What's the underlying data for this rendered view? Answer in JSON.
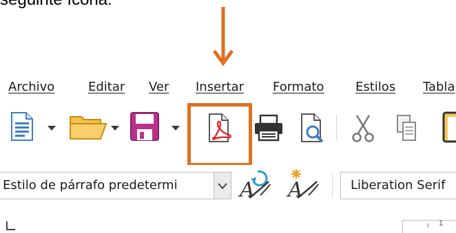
{
  "caption": {
    "text": "seguinte ícona:"
  },
  "menu": {
    "items": [
      {
        "label": "Archivo"
      },
      {
        "label": "Editar"
      },
      {
        "label": "Ver"
      },
      {
        "label": "Insertar"
      },
      {
        "label": "Formato"
      },
      {
        "label": "Estilos"
      },
      {
        "label": "Tabla"
      }
    ]
  },
  "toolbar": {
    "icons": [
      "new-document-icon",
      "open-folder-icon",
      "save-icon",
      "export-pdf-icon",
      "print-icon",
      "print-preview-icon",
      "cut-icon",
      "copy-icon",
      "paste-icon"
    ],
    "highlight_color": "#e07020",
    "arrow_color": "#e07020"
  },
  "formatting": {
    "paragraph_style": "Estilo de párrafo predetermi",
    "font_name": "Liberation Serif",
    "icons": [
      "update-style-icon",
      "new-style-icon"
    ]
  },
  "ruler": {
    "label": "1"
  }
}
